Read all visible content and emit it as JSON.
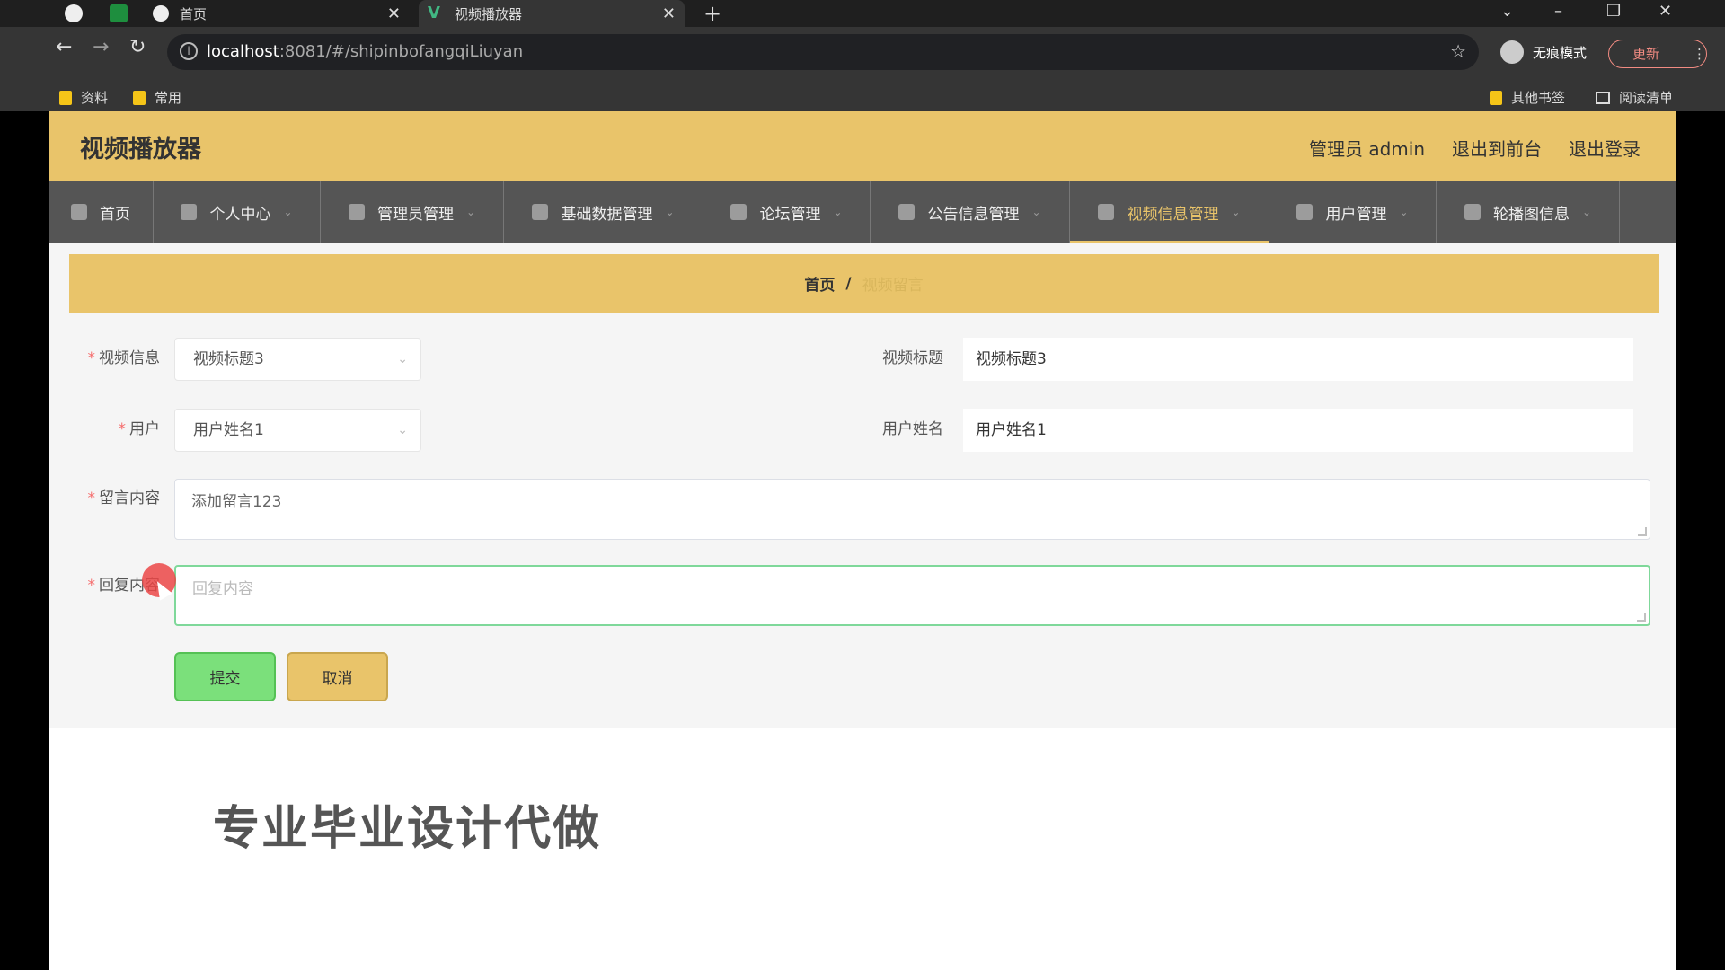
{
  "browser": {
    "tabs": [
      {
        "title": "首页",
        "active": false
      },
      {
        "title": "视频播放器",
        "active": true
      }
    ],
    "url_host": "localhost",
    "url_rest": ":8081/#/shipinbofangqiLiuyan",
    "incognito_label": "无痕模式",
    "update_label": "更新",
    "bookmarks": [
      "资料",
      "常用"
    ],
    "bookmarks_right": [
      "其他书签",
      "阅读清单"
    ]
  },
  "header": {
    "title": "视频播放器",
    "links": [
      "管理员 admin",
      "退出到前台",
      "退出登录"
    ]
  },
  "menu": [
    {
      "label": "首页",
      "has_caret": false,
      "active": false,
      "icon": "home-icon"
    },
    {
      "label": "个人中心",
      "has_caret": true,
      "active": false,
      "icon": "user-icon"
    },
    {
      "label": "管理员管理",
      "has_caret": true,
      "active": false,
      "icon": "doc-icon"
    },
    {
      "label": "基础数据管理",
      "has_caret": true,
      "active": false,
      "icon": "grid-icon"
    },
    {
      "label": "论坛管理",
      "has_caret": true,
      "active": false,
      "icon": "mic-icon"
    },
    {
      "label": "公告信息管理",
      "has_caret": true,
      "active": false,
      "icon": "frame-icon"
    },
    {
      "label": "视频信息管理",
      "has_caret": true,
      "active": true,
      "icon": "comment-icon"
    },
    {
      "label": "用户管理",
      "has_caret": true,
      "active": false,
      "icon": "briefcase-icon"
    },
    {
      "label": "轮播图信息",
      "has_caret": true,
      "active": false,
      "icon": "clock-icon"
    }
  ],
  "breadcrumb": {
    "home": "首页",
    "separator": "/",
    "current": "视频留言"
  },
  "form": {
    "video_label": "视频信息",
    "video_value": "视频标题3",
    "video_title_label": "视频标题",
    "video_title_value": "视频标题3",
    "user_label": "用户",
    "user_value": "用户姓名1",
    "user_name_label": "用户姓名",
    "user_name_value": "用户姓名1",
    "message_label": "留言内容",
    "message_value": "添加留言123",
    "reply_label": "回复内容",
    "reply_placeholder": "回复内容",
    "required_mark": "*",
    "submit_label": "提交",
    "cancel_label": "取消"
  },
  "watermark": "专业毕业设计代做",
  "colors": {
    "accent": "#e9c46a",
    "menu_bg": "#555555",
    "submit": "#7be07b",
    "required": "#f56c6c"
  }
}
